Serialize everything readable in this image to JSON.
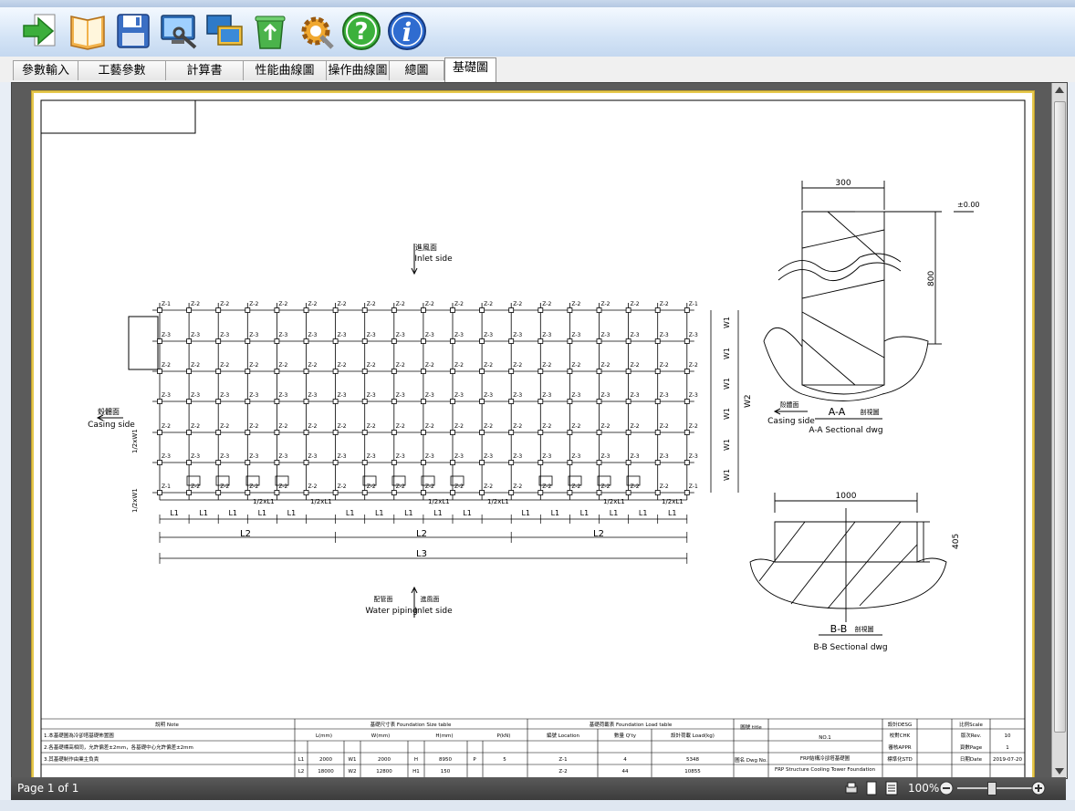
{
  "toolbar": {
    "buttons": [
      {
        "name": "import-arrow-icon"
      },
      {
        "name": "book-icon"
      },
      {
        "name": "save-icon"
      },
      {
        "name": "monitor-settings-icon"
      },
      {
        "name": "window-switch-icon"
      },
      {
        "name": "recycle-bin-icon"
      },
      {
        "name": "gear-wrench-icon"
      },
      {
        "name": "help-icon",
        "glyph": "?"
      },
      {
        "name": "info-icon",
        "glyph": "i"
      }
    ]
  },
  "tabs": [
    {
      "label": "參數輸入"
    },
    {
      "label": "工藝參數"
    },
    {
      "label": "計算書"
    },
    {
      "label": "性能曲線圖"
    },
    {
      "label": "操作曲線圖"
    },
    {
      "label": "總圖"
    },
    {
      "label": "基礎圖",
      "active": true
    }
  ],
  "drawing": {
    "inlet_cn": "進風面",
    "inlet_en": "Inlet side",
    "casing_cn": "殼體面",
    "casing_en": "Casing side",
    "water_cn": "配管面",
    "water_en": "Water piping",
    "inlet2_cn": "進風面",
    "inlet2_en": "Inlet side",
    "z1": "Z-1",
    "z2": "Z-2",
    "z3": "Z-3",
    "w1": "W1",
    "w2": "W2",
    "half_w1": "1/2xW1",
    "half_l1": "1/2xL1",
    "l1": "L1",
    "l2": "L2",
    "l3": "L3",
    "aa_width": "300",
    "aa_level": "±0.00",
    "aa_depth": "800",
    "aa_casing_cn": "殼體面",
    "aa_casing_en": "Casing side",
    "aa_title_main": "A-A",
    "aa_title_cn": "剖視圖",
    "aa_title_en": "A-A Sectional dwg",
    "bb_width": "1000",
    "bb_depth": "405",
    "bb_title_main": "B-B",
    "bb_title_cn": "剖視圖",
    "bb_title_en": "B-B Sectional dwg"
  },
  "titleblock": {
    "note_header": "說明 Note",
    "note1": "1.本基礎圖為冷卻塔基礎佈置圖",
    "note2": "2.各基礎標高相同，允許偏差±2mm，各基礎中心允許偏差±2mm",
    "note3": "3.其基礎制作由業主負責",
    "size_header": "基礎尺寸表 Foundation Size table",
    "size_cols": [
      "L(mm)",
      "W(mm)",
      "H(mm)",
      "P(kN)"
    ],
    "size_row1": [
      "L1",
      "2000",
      "W1",
      "2000",
      "H",
      "8950",
      "P",
      "5"
    ],
    "size_row2": [
      "L2",
      "18000",
      "W2",
      "12800",
      "H1",
      "150",
      "",
      ""
    ],
    "load_header": "基礎荷載表 Foundation Load table",
    "load_cols": [
      "編號 Location",
      "數量 Q'ty",
      "設計荷載 Load(kg)"
    ],
    "load_row1": [
      "Z-1",
      "4",
      "5348"
    ],
    "load_row2": [
      "Z-2",
      "44",
      "10855"
    ],
    "title_label": "圖號 title",
    "no_value": "NO.1",
    "dwg_label": "圖名 Dwg No.",
    "dwg_cn": "FRP結構冷卻塔基礎圖",
    "dwg_en": "FRP Structure Cooling Tower Foundation",
    "design": "設計DESG",
    "check": "校對CHK",
    "approve": "審核APPR",
    "std": "標準化STD",
    "scale": "比例Scale",
    "rev": "版次Rev.",
    "rev_value": "10",
    "page_label": "頁數Page",
    "page_value": "1",
    "date_label": "日期Date",
    "date_value": "2019-07-20"
  },
  "status": {
    "page_text": "Page 1 of 1",
    "zoom": "100%"
  }
}
